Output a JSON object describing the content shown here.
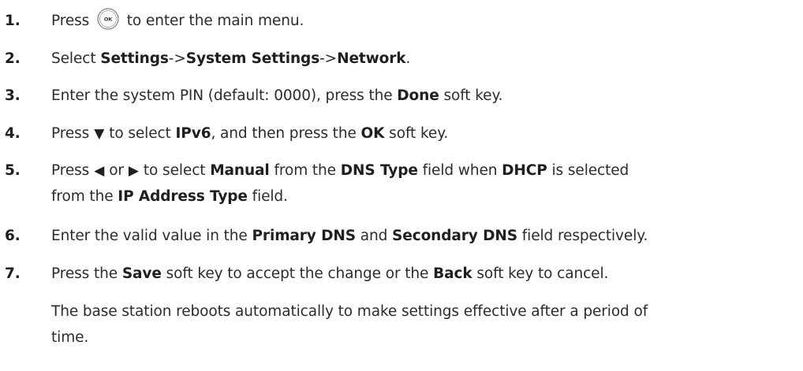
{
  "steps": [
    {
      "num": "1.",
      "parts": {
        "a": "Press",
        "b": "to enter the main menu."
      },
      "icon": "ok-button-icon"
    },
    {
      "num": "2.",
      "parts": {
        "a": "Select ",
        "b1": "Settings",
        "c": "->",
        "b2": "System Settings",
        "d": "->",
        "b3": "Network",
        "e": "."
      }
    },
    {
      "num": "3.",
      "parts": {
        "a": "Enter the system PIN (default: 0000), press the ",
        "b": "Done",
        "c": " soft key."
      }
    },
    {
      "num": "4.",
      "parts": {
        "a": "Press",
        "glyph": "▼",
        "b": "to select ",
        "b1": "IPv6",
        "c": ", and then press the ",
        "b2": "OK",
        "d": " soft key."
      }
    },
    {
      "num": "5.",
      "parts": {
        "a": "Press",
        "glyph1": "◀",
        "or": "or",
        "glyph2": "▶",
        "b": "to select ",
        "b1": "Manual",
        "c": " from the ",
        "b2": "DNS Type",
        "d": " field when ",
        "b3": "DHCP",
        "e": " is selected",
        "l2a": "from the ",
        "l2b": "IP Address Type",
        "l2c": " field."
      }
    },
    {
      "num": "6.",
      "parts": {
        "a": "Enter the valid value in the ",
        "b1": "Primary DNS",
        "c": " and ",
        "b2": "Secondary DNS",
        "d": " field respectively."
      }
    },
    {
      "num": "7.",
      "parts": {
        "a": "Press the ",
        "b1": "Save",
        "c": " soft key to accept the change or the ",
        "b2": "Back",
        "d": " soft key to cancel."
      }
    }
  ],
  "note": {
    "line1": "The base station reboots automatically to make settings effective after a period of",
    "line2": "time."
  }
}
